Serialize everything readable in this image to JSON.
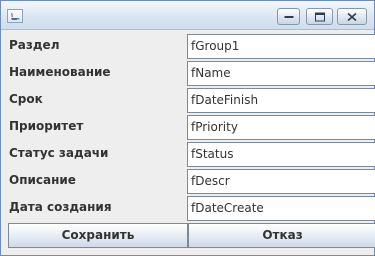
{
  "window": {
    "icon": "java-cup-icon",
    "controls": [
      "minimize-icon",
      "maximize-icon",
      "close-icon"
    ]
  },
  "form": {
    "rows": [
      {
        "label": "Раздел",
        "value": "fGroup1"
      },
      {
        "label": "Наименование",
        "value": "fName"
      },
      {
        "label": "Срок",
        "value": "fDateFinish"
      },
      {
        "label": "Приоритет",
        "value": "fPriority"
      },
      {
        "label": "Статус задачи",
        "value": "fStatus"
      },
      {
        "label": "Описание",
        "value": "fDescr"
      },
      {
        "label": "Дата создания",
        "value": "fDateCreate"
      }
    ]
  },
  "buttons": {
    "save_label": "Сохранить",
    "cancel_label": "Отказ"
  }
}
